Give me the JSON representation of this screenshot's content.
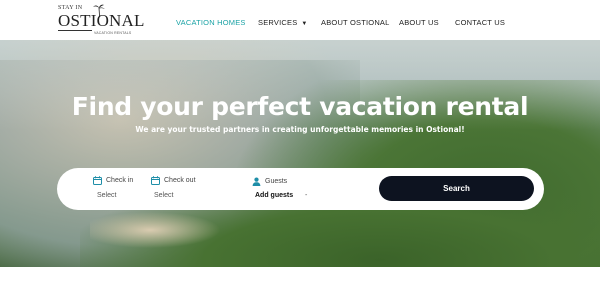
{
  "header": {
    "logo": {
      "top_text": "STAY IN",
      "name": "OSTIONAL",
      "tagline": "VACATION RENTALS"
    },
    "nav": [
      {
        "label": "VACATION HOMES",
        "active": true
      },
      {
        "label": "SERVICES",
        "has_dropdown": true
      },
      {
        "label": "ABOUT OSTIONAL"
      },
      {
        "label": "ABOUT US"
      },
      {
        "label": "CONTACT US"
      }
    ]
  },
  "hero": {
    "title": "Find your perfect vacation rental",
    "subtitle": "We are your trusted partners in creating unforgettable memories in Ostional!"
  },
  "search": {
    "checkin_label": "Check in",
    "checkin_value": "Select",
    "checkout_label": "Check out",
    "checkout_value": "Select",
    "guests_label": "Guests",
    "guests_value": "Add guests",
    "guests_dash": "-",
    "button_label": "Search"
  },
  "colors": {
    "accent": "#1ba3a6",
    "button": "#0d1320",
    "icon": "#1e8ea8"
  }
}
